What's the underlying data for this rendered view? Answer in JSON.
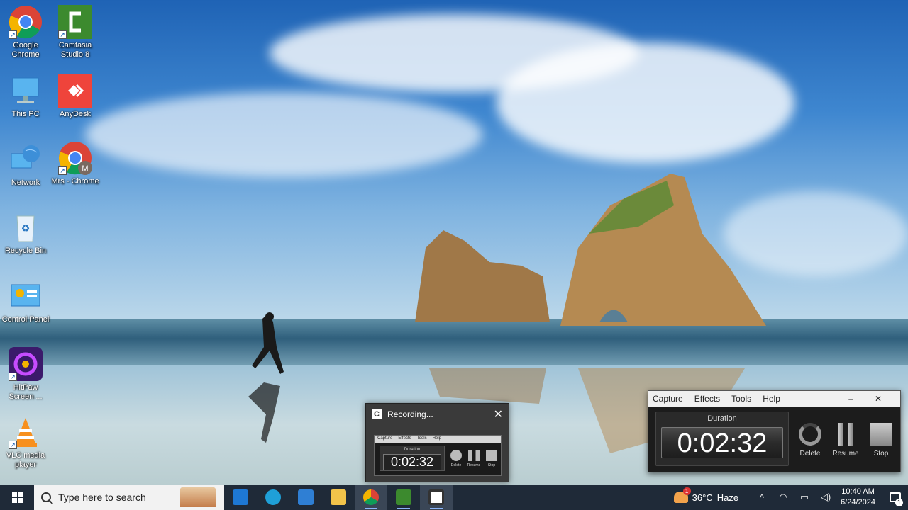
{
  "desktop_icons": [
    {
      "label": "Google Chrome",
      "icon": "chrome-icon"
    },
    {
      "label": "Camtasia Studio 8",
      "icon": "camtasia-icon"
    },
    {
      "label": "This PC",
      "icon": "computer-icon"
    },
    {
      "label": "AnyDesk",
      "icon": "anydesk-icon"
    },
    {
      "label": "Network",
      "icon": "network-icon"
    },
    {
      "label": "Mrs - Chrome",
      "icon": "chrome-profile-icon",
      "badge": "M"
    },
    {
      "label": "Recycle Bin",
      "icon": "recycle-bin-icon"
    },
    {
      "label": "Control Panel",
      "icon": "control-panel-icon"
    },
    {
      "label": "HitPaw Screen ...",
      "icon": "hitpaw-icon"
    },
    {
      "label": "VLC media player",
      "icon": "vlc-icon"
    }
  ],
  "recording_popup": {
    "title": "Recording...",
    "close_glyph": "✕",
    "thumb_menu": [
      "Capture",
      "Effects",
      "Tools",
      "Help"
    ],
    "thumb_duration_label": "Duration",
    "thumb_time": "0:02:32",
    "thumb_buttons": [
      "Delete",
      "Resume",
      "Stop"
    ]
  },
  "recorder": {
    "menu": [
      "Capture",
      "Effects",
      "Tools",
      "Help"
    ],
    "minimize_glyph": "–",
    "close_glyph": "✕",
    "duration_label": "Duration",
    "time": "0:02:32",
    "buttons": {
      "delete": "Delete",
      "resume": "Resume",
      "stop": "Stop"
    }
  },
  "taskbar": {
    "search_placeholder": "Type here to search",
    "apps": [
      {
        "icon": "mail-icon",
        "color": "#1e78d4"
      },
      {
        "icon": "edge-icon",
        "color": "#1fa0d8"
      },
      {
        "icon": "store-icon",
        "color": "#2f7fd4"
      },
      {
        "icon": "file-explorer-icon",
        "color": "#f2c34a"
      },
      {
        "icon": "chrome-icon",
        "color": "#e0463a"
      },
      {
        "icon": "camtasia-icon",
        "color": "#3c8a2e"
      },
      {
        "icon": "camtasia-recorder-icon",
        "color": "#ffffff"
      }
    ],
    "weather_badge": "1",
    "temperature": "36°C",
    "weather": "Haze",
    "time": "10:40 AM",
    "date": "6/24/2024",
    "notifications": "1",
    "chevron_glyph": "^",
    "wifi_glyph": "◠",
    "meet_glyph": "▭",
    "volume_glyph": "◁)"
  }
}
